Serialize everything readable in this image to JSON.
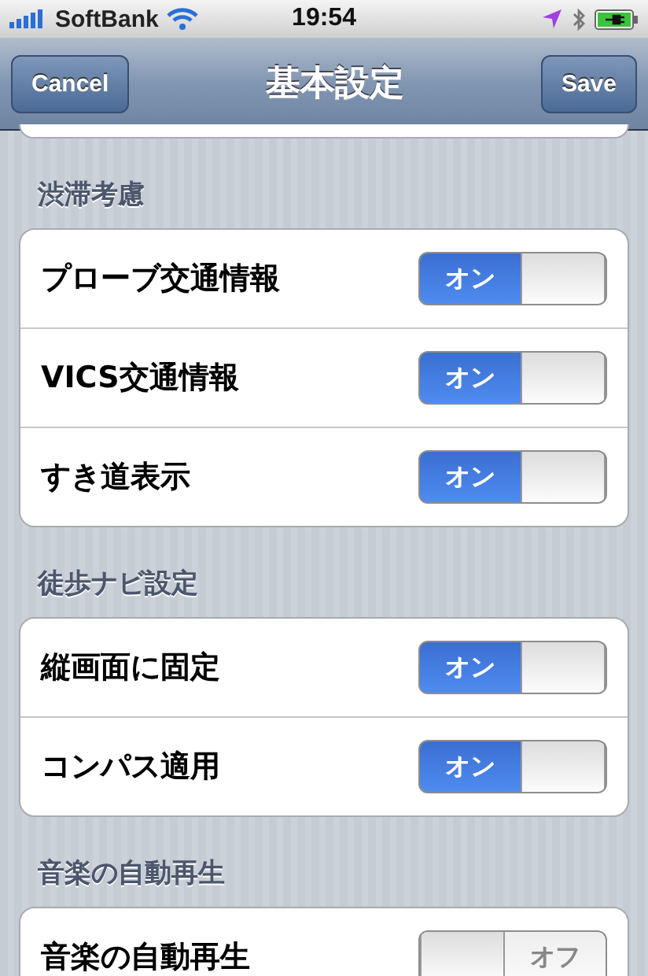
{
  "status_bar": {
    "carrier": "SoftBank",
    "time": "19:54"
  },
  "nav_bar": {
    "left_button": "Cancel",
    "title": "基本設定",
    "right_button": "Save"
  },
  "sections": [
    {
      "header": "渋滞考慮",
      "rows": [
        {
          "label": "プローブ交通情報",
          "on": true,
          "switch_label": "オン"
        },
        {
          "label": "VICS交通情報",
          "on": true,
          "switch_label": "オン"
        },
        {
          "label": "すき道表示",
          "on": true,
          "switch_label": "オン"
        }
      ]
    },
    {
      "header": "徒歩ナビ設定",
      "rows": [
        {
          "label": "縦画面に固定",
          "on": true,
          "switch_label": "オン"
        },
        {
          "label": "コンパス適用",
          "on": true,
          "switch_label": "オン"
        }
      ]
    },
    {
      "header": "音楽の自動再生",
      "rows": [
        {
          "label": "音楽の自動再生",
          "on": false,
          "switch_label": "オフ"
        }
      ]
    }
  ]
}
